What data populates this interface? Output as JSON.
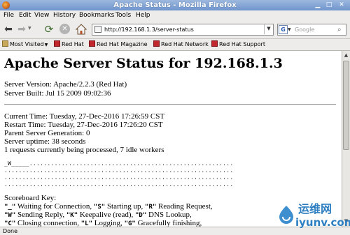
{
  "window": {
    "title": "Apache Status - Mozilla Firefox"
  },
  "menu": [
    "File",
    "Edit",
    "View",
    "History",
    "Bookmarks",
    "Tools",
    "Help"
  ],
  "nav": {
    "url": "http://192.168.1.3/server-status",
    "search_placeholder": "Google"
  },
  "bookmarks": [
    "Most Visited",
    "Red Hat",
    "Red Hat Magazine",
    "Red Hat Network",
    "Red Hat Support"
  ],
  "page": {
    "heading": "Apache Server Status for 192.168.1.3",
    "server_version": "Server Version: Apache/2.2.3 (Red Hat)",
    "server_built": "Server Built: Jul 15 2009 09:02:36",
    "current_time": "Current Time: Tuesday, 27-Dec-2016 17:26:59 CST",
    "restart_time": "Restart Time: Tuesday, 27-Dec-2016 17:26:20 CST",
    "generation": "Parent Server Generation: 0",
    "uptime": "Server uptime: 38 seconds",
    "requests": "1 requests currently being processed, 7 idle workers",
    "scoreboard": [
      "_W_____.........................................................",
      "................................................................",
      "................................................................",
      "................................................................"
    ],
    "key_title": "Scoreboard Key:",
    "key_lines": [
      [
        {
          "code": "\"_\"",
          "text": " Waiting for Connection, "
        },
        {
          "code": "\"S\"",
          "text": " Starting up, "
        },
        {
          "code": "\"R\"",
          "text": " Reading Request,"
        }
      ],
      [
        {
          "code": "\"W\"",
          "text": " Sending Reply, "
        },
        {
          "code": "\"K\"",
          "text": " Keepalive (read), "
        },
        {
          "code": "\"D\"",
          "text": " DNS Lookup,"
        }
      ],
      [
        {
          "code": "\"C\"",
          "text": " Closing connection, "
        },
        {
          "code": "\"L\"",
          "text": " Logging, "
        },
        {
          "code": "\"G\"",
          "text": " Gracefully finishing,"
        }
      ]
    ]
  },
  "status": "Done",
  "watermark": {
    "cn": "运维网",
    "url": "iyunv.com"
  }
}
